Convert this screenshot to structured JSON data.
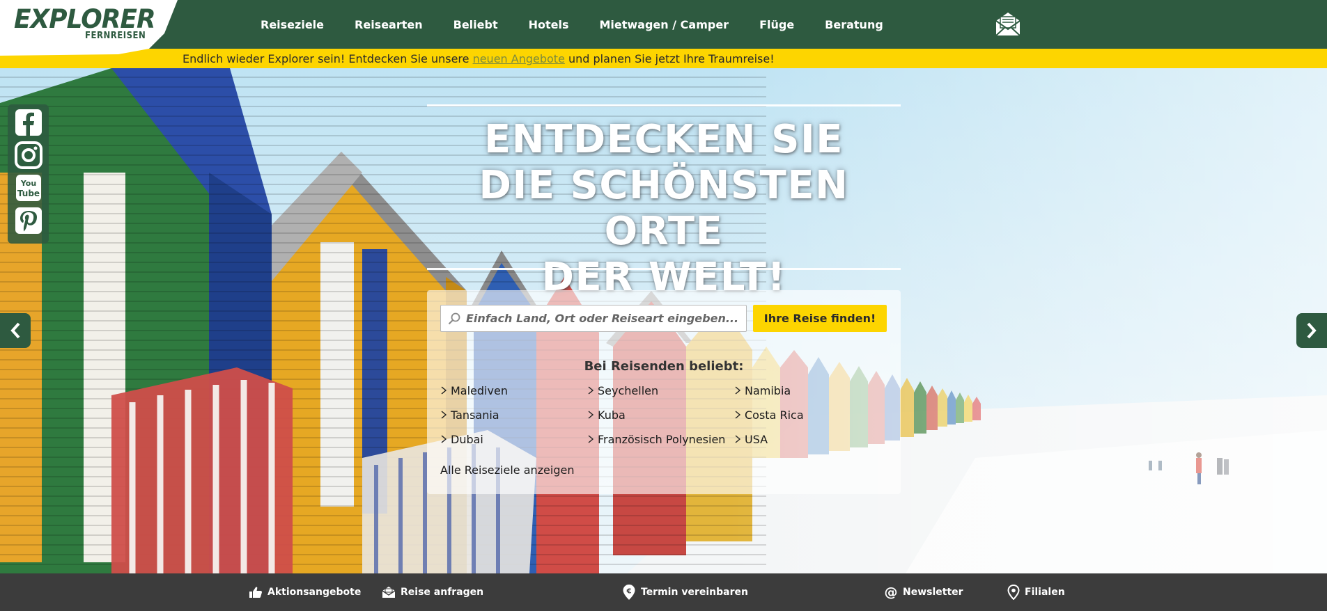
{
  "header": {
    "logo_main": "EXPLORER",
    "logo_sub": "FERNREISEN",
    "nav": [
      "Reiseziele",
      "Reisearten",
      "Beliebt",
      "Hotels",
      "Mietwagen / Camper",
      "Flüge",
      "Beratung"
    ]
  },
  "announcement": {
    "prefix": "Endlich wieder Explorer sein! Entdecken Sie unsere ",
    "link": "neuen Angebote",
    "suffix": " und planen Sie jetzt Ihre Traumreise!"
  },
  "social": [
    "facebook-icon",
    "instagram-icon",
    "youtube-icon",
    "pinterest-icon"
  ],
  "hero": {
    "headline_1": "ENTDECKEN SIE",
    "headline_2": "DIE SCHÖNSTEN ORTE",
    "headline_3": "DER WELT!"
  },
  "search": {
    "placeholder": "Einfach Land, Ort oder Reiseart eingeben...",
    "button": "Ihre Reise finden!",
    "popular_title": "Bei Reisenden beliebt:",
    "destinations": [
      "Malediven",
      "Seychellen",
      "Namibia",
      "Tansania",
      "Kuba",
      "Costa Rica",
      "Dubai",
      "Französisch Polynesien",
      "USA"
    ],
    "all_link": "Alle Reiseziele anzeigen"
  },
  "bottom_bar": {
    "offers": "Aktionsangebote",
    "request": "Reise anfragen",
    "appointment": "Termin vereinbaren",
    "newsletter": "Newsletter",
    "branches": "Filialen"
  },
  "colors": {
    "brand_green": "#2e5a40",
    "accent_yellow": "#fdd500",
    "bottom_bar": "#3c3c3c"
  }
}
